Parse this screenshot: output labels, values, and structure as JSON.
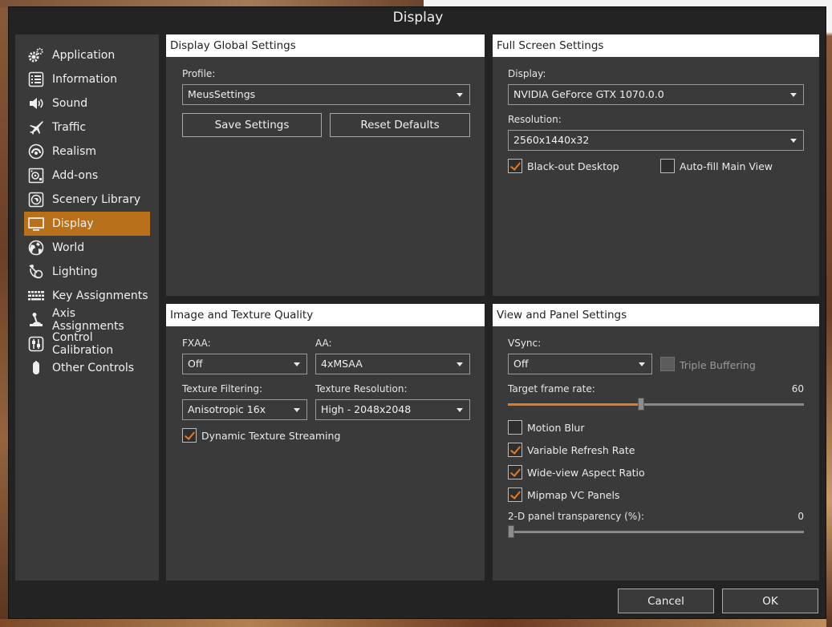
{
  "window": {
    "title": "Display"
  },
  "sidebar": {
    "items": [
      {
        "label": "Application",
        "icon": "gear-icon",
        "active": false
      },
      {
        "label": "Information",
        "icon": "list-icon",
        "active": false
      },
      {
        "label": "Sound",
        "icon": "speaker-icon",
        "active": false
      },
      {
        "label": "Traffic",
        "icon": "airplane-icon",
        "active": false
      },
      {
        "label": "Realism",
        "icon": "realism-icon",
        "active": false
      },
      {
        "label": "Add-ons",
        "icon": "addons-icon",
        "active": false
      },
      {
        "label": "Scenery Library",
        "icon": "scenery-icon",
        "active": false
      },
      {
        "label": "Display",
        "icon": "monitor-icon",
        "active": true
      },
      {
        "label": "World",
        "icon": "globe-icon",
        "active": false
      },
      {
        "label": "Lighting",
        "icon": "lighting-icon",
        "active": false
      },
      {
        "label": "Key Assignments",
        "icon": "keyboard-icon",
        "active": false
      },
      {
        "label": "Axis Assignments",
        "icon": "joystick-icon",
        "active": false
      },
      {
        "label": "Control Calibration",
        "icon": "calibration-icon",
        "active": false
      },
      {
        "label": "Other Controls",
        "icon": "mouse-icon",
        "active": false
      }
    ]
  },
  "global": {
    "header": "Display Global Settings",
    "profile_label": "Profile:",
    "profile_value": "MeusSettings",
    "save_label": "Save Settings",
    "reset_label": "Reset Defaults"
  },
  "fullscreen": {
    "header": "Full Screen Settings",
    "display_label": "Display:",
    "display_value": "NVIDIA GeForce GTX 1070.0.0",
    "resolution_label": "Resolution:",
    "resolution_value": "2560x1440x32",
    "blackout_label": "Black-out Desktop",
    "blackout_checked": true,
    "autofill_label": "Auto-fill Main View",
    "autofill_checked": false
  },
  "image": {
    "header": "Image and Texture Quality",
    "fxaa_label": "FXAA:",
    "fxaa_value": "Off",
    "aa_label": "AA:",
    "aa_value": "4xMSAA",
    "texfilter_label": "Texture Filtering:",
    "texfilter_value": "Anisotropic 16x",
    "texres_label": "Texture Resolution:",
    "texres_value": "High - 2048x2048",
    "streaming_label": "Dynamic Texture Streaming",
    "streaming_checked": true
  },
  "view": {
    "header": "View and Panel Settings",
    "vsync_label": "VSync:",
    "vsync_value": "Off",
    "triple_label": "Triple Buffering",
    "triple_checked": false,
    "target_label": "Target frame rate:",
    "target_value": "60",
    "target_fraction": 0.45,
    "motionblur_label": "Motion Blur",
    "motionblur_checked": false,
    "vrr_label": "Variable Refresh Rate",
    "vrr_checked": true,
    "wideview_label": "Wide-view Aspect Ratio",
    "wideview_checked": true,
    "mipmap_label": "Mipmap VC Panels",
    "mipmap_checked": true,
    "transparency_label": "2-D panel transparency (%):",
    "transparency_value": "0",
    "transparency_fraction": 0.0
  },
  "footer": {
    "cancel_label": "Cancel",
    "ok_label": "OK"
  },
  "colors": {
    "accent": "#b8701a",
    "check": "#e07a2a",
    "panel": "#3a3a3a",
    "window": "#232323"
  }
}
